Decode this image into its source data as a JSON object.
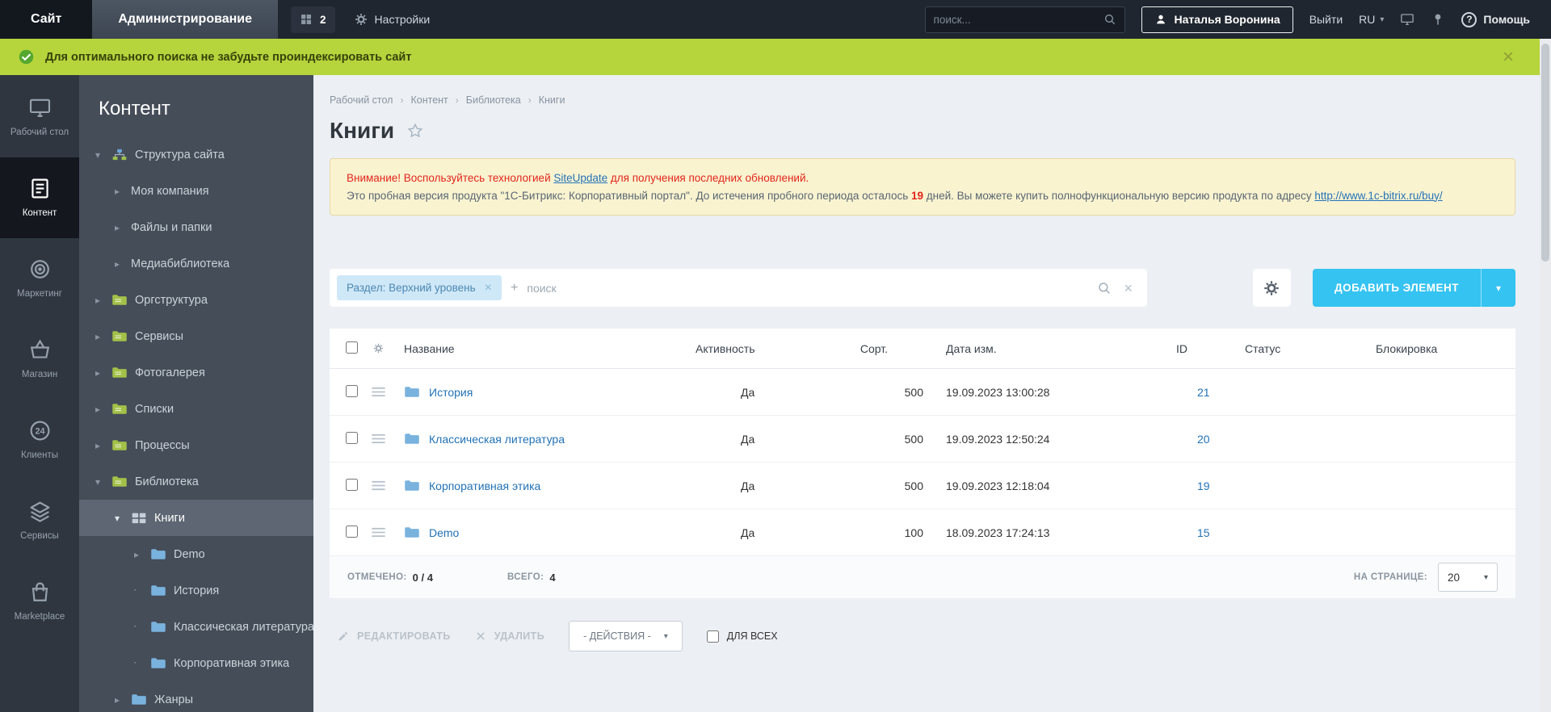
{
  "topbar": {
    "site_tab": "Сайт",
    "admin_tab": "Администрирование",
    "counter": "2",
    "settings_label": "Настройки",
    "search_placeholder": "поиск...",
    "user_name": "Наталья Воронина",
    "logout_label": "Выйти",
    "lang_label": "RU",
    "help_label": "Помощь"
  },
  "notice": {
    "text": "Для оптимального поиска не забудьте проиндексировать сайт"
  },
  "rail": {
    "items": [
      {
        "label": "Рабочий стол"
      },
      {
        "label": "Контент"
      },
      {
        "label": "Маркетинг"
      },
      {
        "label": "Магазин"
      },
      {
        "label": "Клиенты"
      },
      {
        "label": "Сервисы"
      },
      {
        "label": "Marketplace"
      }
    ]
  },
  "sidebar": {
    "title": "Контент",
    "items": [
      {
        "label": "Структура сайта"
      },
      {
        "label": "Моя компания"
      },
      {
        "label": "Файлы и папки"
      },
      {
        "label": "Медиабиблиотека"
      },
      {
        "label": "Оргструктура"
      },
      {
        "label": "Сервисы"
      },
      {
        "label": "Фотогалерея"
      },
      {
        "label": "Списки"
      },
      {
        "label": "Процессы"
      },
      {
        "label": "Библиотека"
      },
      {
        "label": "Книги"
      },
      {
        "label": "Demo"
      },
      {
        "label": "История"
      },
      {
        "label": "Классическая литература"
      },
      {
        "label": "Корпоративная этика"
      },
      {
        "label": "Жанры"
      }
    ]
  },
  "breadcrumb": {
    "items": [
      "Рабочий стол",
      "Контент",
      "Библиотека",
      "Книги"
    ]
  },
  "page": {
    "title": "Книги"
  },
  "warning": {
    "attention_text_1": "Внимание! Воспользуйтесь технологией ",
    "siteupdate_link": "SiteUpdate",
    "attention_text_2": " для получения последних обновлений.",
    "trial_text_1": "Это пробная версия продукта \"1С-Битрикс: Корпоративный портал\". До истечения пробного периода осталось ",
    "trial_days": "19",
    "trial_text_2": " дней. Вы можете купить полнофункциональную версию продукта по адресу ",
    "buy_link": "http://www.1c-bitrix.ru/buy/"
  },
  "filter": {
    "chip_label": "Раздел: Верхний уровень",
    "search_placeholder": "поиск",
    "add_button_label": "ДОБАВИТЬ ЭЛЕМЕНТ"
  },
  "table": {
    "headers": {
      "name": "Название",
      "active": "Активность",
      "sort": "Сорт.",
      "modified": "Дата изм.",
      "id": "ID",
      "status": "Статус",
      "lock": "Блокировка"
    },
    "rows": [
      {
        "name": "История",
        "active": "Да",
        "sort": "500",
        "modified": "19.09.2023 13:00:28",
        "id": "21",
        "status": "",
        "lock": ""
      },
      {
        "name": "Классическая литература",
        "active": "Да",
        "sort": "500",
        "modified": "19.09.2023 12:50:24",
        "id": "20",
        "status": "",
        "lock": ""
      },
      {
        "name": "Корпоративная этика",
        "active": "Да",
        "sort": "500",
        "modified": "19.09.2023 12:18:04",
        "id": "19",
        "status": "",
        "lock": ""
      },
      {
        "name": "Demo",
        "active": "Да",
        "sort": "100",
        "modified": "18.09.2023 17:24:13",
        "id": "15",
        "status": "",
        "lock": ""
      }
    ],
    "footer": {
      "checked_label": "ОТМЕЧЕНО:",
      "checked_value": "0 / 4",
      "total_label": "ВСЕГО:",
      "total_value": "4",
      "per_page_label": "НА СТРАНИЦЕ:",
      "per_page_value": "20"
    }
  },
  "actions": {
    "edit_label": "РЕДАКТИРОВАТЬ",
    "delete_label": "УДАЛИТЬ",
    "menu_label": "- ДЕЙСТВИЯ -",
    "for_all_label": "ДЛЯ ВСЕХ"
  },
  "glyphs": {
    "close": "×",
    "plus": "+",
    "crumb_sep": "›",
    "caret_down": "▾",
    "arrow_right": "▸",
    "arrow_down": "▾",
    "bullet": "▪",
    "question": "?"
  },
  "colors": {
    "accent_blue": "#35c3f1",
    "notice_green": "#b6d43c",
    "link_blue": "#2272b6",
    "danger_red": "#e2251c",
    "warning_bg": "#f9f3d0",
    "sidebar_bg": "#454d59",
    "topbar_bg": "#20262f"
  }
}
